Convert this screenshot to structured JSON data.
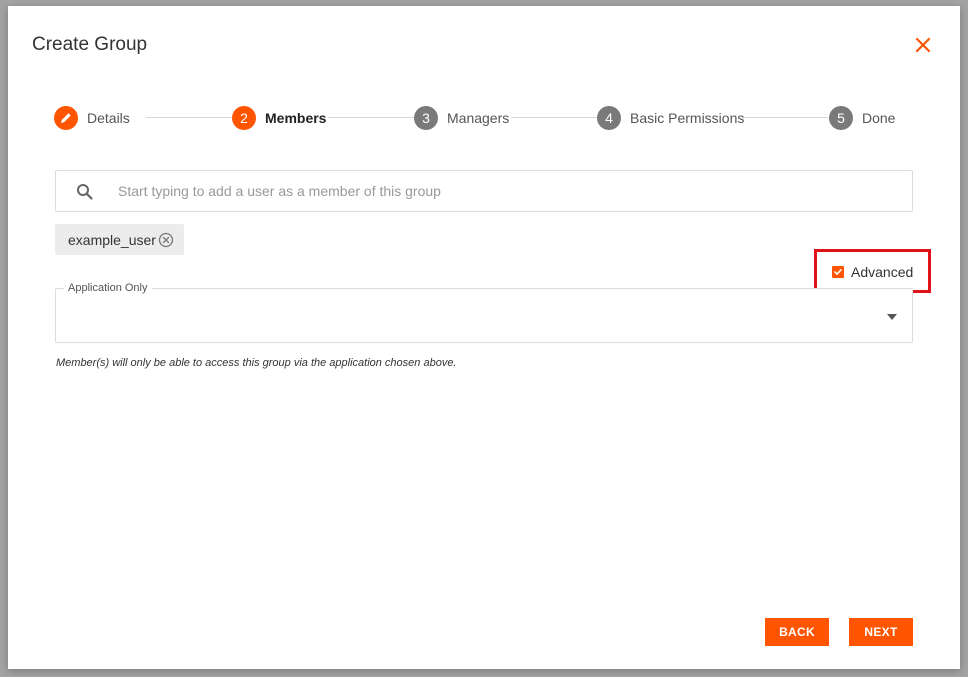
{
  "dialog": {
    "title": "Create Group"
  },
  "stepper": {
    "steps": [
      {
        "number": "",
        "label": "Details",
        "state": "completed",
        "icon": "pencil-icon"
      },
      {
        "number": "2",
        "label": "Members",
        "state": "current"
      },
      {
        "number": "3",
        "label": "Managers",
        "state": "upcoming"
      },
      {
        "number": "4",
        "label": "Basic Permissions",
        "state": "upcoming"
      },
      {
        "number": "5",
        "label": "Done",
        "state": "upcoming"
      }
    ]
  },
  "search": {
    "placeholder": "Start typing to add a user as a member of this group",
    "value": "",
    "icon": "search-icon"
  },
  "members": [
    {
      "label": "example_user",
      "remove_icon": "circle-x-icon"
    }
  ],
  "advanced": {
    "label": "Advanced",
    "checked": true
  },
  "application_select": {
    "label": "Application Only",
    "value": "",
    "helper": "Member(s) will only be able to access this group via the application chosen above."
  },
  "footer": {
    "back_label": "BACK",
    "next_label": "NEXT"
  },
  "colors": {
    "accent": "#ff5500",
    "highlight": "#e0131a",
    "inactive_step": "#7a7a7a"
  }
}
